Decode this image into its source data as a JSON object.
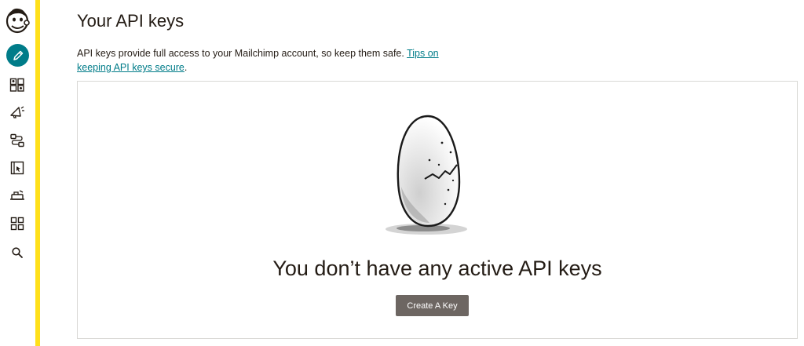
{
  "app": {
    "brand": "Mailchimp",
    "accent_color": "#ffe01b",
    "link_color": "#007c89",
    "button_color": "#6d6662"
  },
  "nav": {
    "items": [
      {
        "id": "create",
        "icon": "pencil-icon",
        "active": true
      },
      {
        "id": "audience",
        "icon": "audience-icon"
      },
      {
        "id": "campaigns",
        "icon": "megaphone-icon"
      },
      {
        "id": "automations",
        "icon": "automation-icon"
      },
      {
        "id": "website",
        "icon": "website-icon"
      },
      {
        "id": "integrations",
        "icon": "integrations-icon"
      },
      {
        "id": "dashboards",
        "icon": "grid-icon"
      },
      {
        "id": "search",
        "icon": "search-icon"
      }
    ]
  },
  "page": {
    "title": "Your API keys",
    "description": "API keys provide full access to your Mailchimp account, so keep them safe.",
    "tips_link": "Tips on keeping API keys secure",
    "description_end": "."
  },
  "empty_state": {
    "illustration": "cracked-egg",
    "heading": "You don’t have any active API keys",
    "button_label": "Create A Key"
  }
}
